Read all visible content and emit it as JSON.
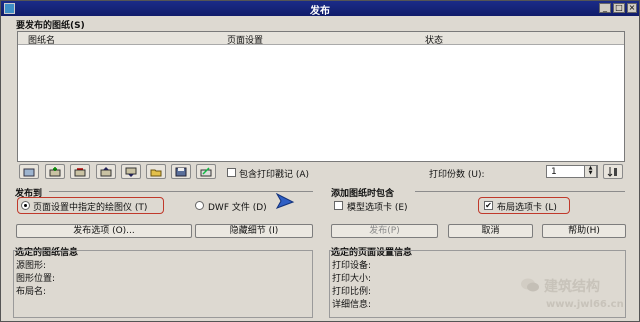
{
  "window": {
    "title": "发布"
  },
  "sheets_section": {
    "title": "要发布的图纸(S)",
    "columns": [
      "图纸名",
      "页面设置",
      "状态"
    ]
  },
  "toolbar": {
    "include_stamp_label": "包含打印戳记 (A)",
    "copies_label": "打印份数 (U):",
    "copies_value": "1"
  },
  "publish_to": {
    "title": "发布到",
    "option_plotter": "页面设置中指定的绘图仪 (T)",
    "option_dwf": "DWF 文件 (D)",
    "selected": "plotter"
  },
  "add_sheets": {
    "title": "添加图纸时包含",
    "model_tab_label": "模型选项卡 (E)",
    "model_tab_checked": false,
    "layout_tab_label": "布局选项卡 (L)",
    "layout_tab_checked": true
  },
  "buttons": {
    "publish_options": "发布选项 (O)...",
    "hide_details": "隐藏细节 (I)",
    "publish": "发布(P)",
    "cancel": "取消",
    "help": "帮助(H)"
  },
  "selected_sheet_info": {
    "title": "选定的图纸信息",
    "fields": [
      "源图形:",
      "图形位置:",
      "布局名:"
    ]
  },
  "selected_page_setup_info": {
    "title": "选定的页面设置信息",
    "fields": [
      "打印设备:",
      "打印大小:",
      "打印比例:",
      "详细信息:"
    ]
  },
  "watermark": {
    "brand": "建筑结构",
    "url": "www.jwl66.cn"
  }
}
